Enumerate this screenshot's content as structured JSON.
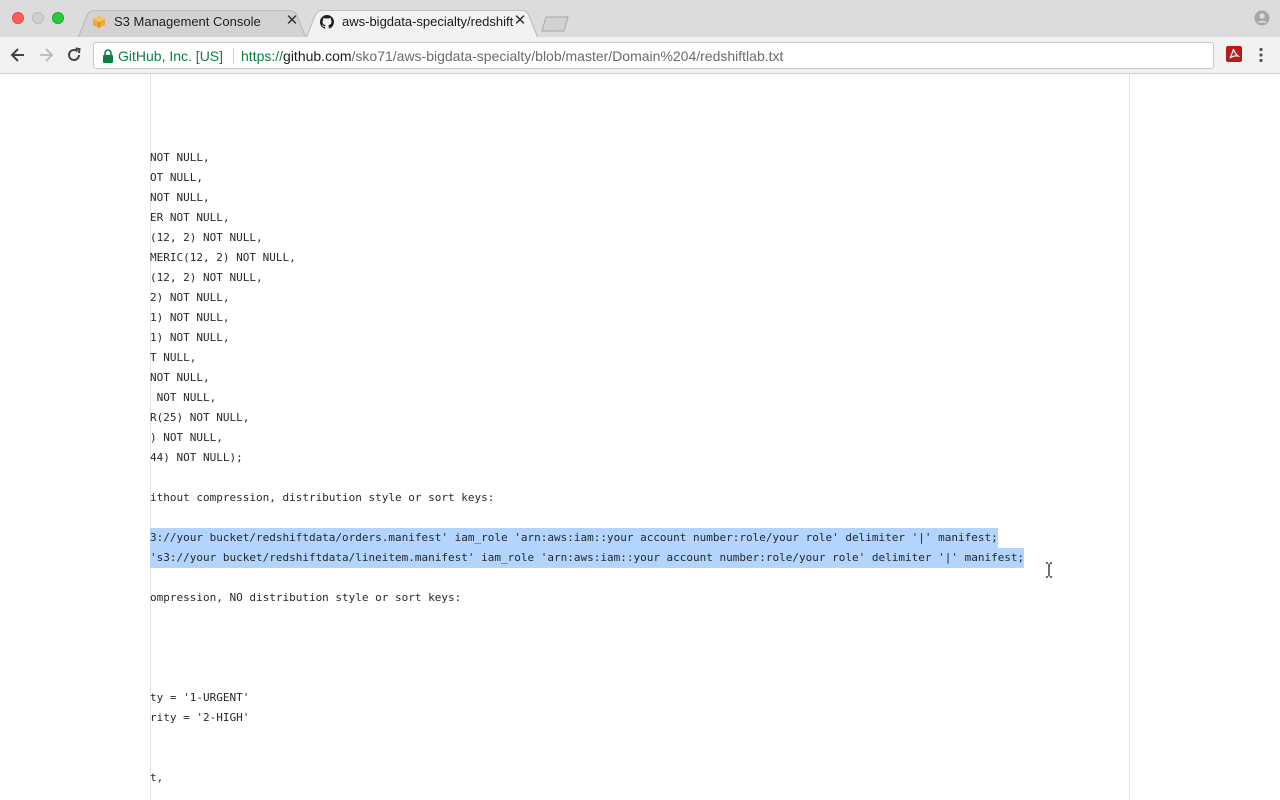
{
  "browser": {
    "tabs": [
      {
        "title": "S3 Management Console",
        "favicon": "aws-cube-icon",
        "active": false
      },
      {
        "title": "aws-bigdata-specialty/redshift",
        "favicon": "github-icon",
        "active": true
      }
    ],
    "address_bar": {
      "ev_label": "GitHub, Inc. [US]",
      "url_scheme": "https://",
      "url_host": "github.com",
      "url_path": "/sko71/aws-bigdata-specialty/blob/master/Domain%204/redshiftlab.txt"
    },
    "colors": {
      "ev_green": "#0b8043",
      "selection": "#b3d4fc"
    }
  },
  "code": {
    "lines": [
      {
        "text": "NOT NULL,",
        "selected": false
      },
      {
        "text": "OT NULL,",
        "selected": false
      },
      {
        "text": "NOT NULL,",
        "selected": false
      },
      {
        "text": "ER NOT NULL,",
        "selected": false
      },
      {
        "text": "(12, 2) NOT NULL,",
        "selected": false
      },
      {
        "text": "MERIC(12, 2) NOT NULL,",
        "selected": false
      },
      {
        "text": "(12, 2) NOT NULL,",
        "selected": false
      },
      {
        "text": "2) NOT NULL,",
        "selected": false
      },
      {
        "text": "1) NOT NULL,",
        "selected": false
      },
      {
        "text": "1) NOT NULL,",
        "selected": false
      },
      {
        "text": "T NULL,",
        "selected": false
      },
      {
        "text": "NOT NULL,",
        "selected": false
      },
      {
        "text": " NOT NULL,",
        "selected": false
      },
      {
        "text": "R(25) NOT NULL,",
        "selected": false
      },
      {
        "text": ") NOT NULL,",
        "selected": false
      },
      {
        "text": "44) NOT NULL);",
        "selected": false
      },
      {
        "text": "",
        "selected": false
      },
      {
        "text": "ithout compression, distribution style or sort keys:",
        "selected": false
      },
      {
        "text": "",
        "selected": false
      },
      {
        "text": "3://your bucket/redshiftdata/orders.manifest' iam_role 'arn:aws:iam::your account number:role/your role' delimiter '|' manifest;",
        "selected": true
      },
      {
        "text": "'s3://your bucket/redshiftdata/lineitem.manifest' iam_role 'arn:aws:iam::your account number:role/your role' delimiter '|' manifest;",
        "selected": true
      },
      {
        "text": "",
        "selected": false
      },
      {
        "text": "ompression, NO distribution style or sort keys:",
        "selected": false
      },
      {
        "text": "",
        "selected": false
      },
      {
        "text": "",
        "selected": false
      },
      {
        "text": "",
        "selected": false
      },
      {
        "text": "",
        "selected": false
      },
      {
        "text": "ty = '1-URGENT'",
        "selected": false
      },
      {
        "text": "rity = '2-HIGH'",
        "selected": false
      },
      {
        "text": "",
        "selected": false
      },
      {
        "text": "",
        "selected": false
      },
      {
        "text": "t,",
        "selected": false
      }
    ]
  }
}
